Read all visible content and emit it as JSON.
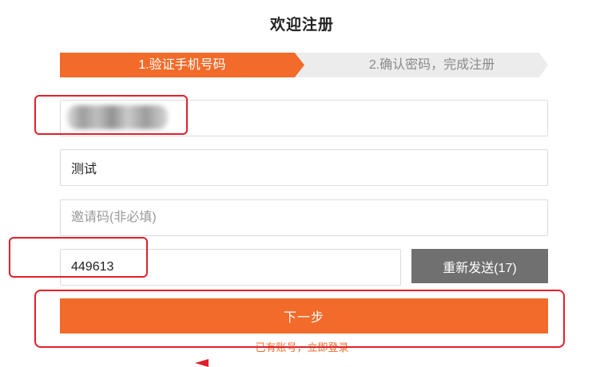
{
  "page": {
    "title": "欢迎注册"
  },
  "steps": [
    {
      "label": "1.验证手机号码",
      "active": true
    },
    {
      "label": "2.确认密码，完成注册",
      "active": false
    }
  ],
  "form": {
    "phone_value": "",
    "name_value": "测试",
    "invite_placeholder": "邀请码(非必填)",
    "code_value": "449613",
    "resend_label": "重新发送(17)",
    "next_label": "下一步",
    "login_link": "已有账号，立即登录"
  },
  "colors": {
    "accent": "#f26b2a",
    "step_inactive": "#ececec",
    "resend_button": "#707070",
    "annotation": "#e0202c"
  }
}
